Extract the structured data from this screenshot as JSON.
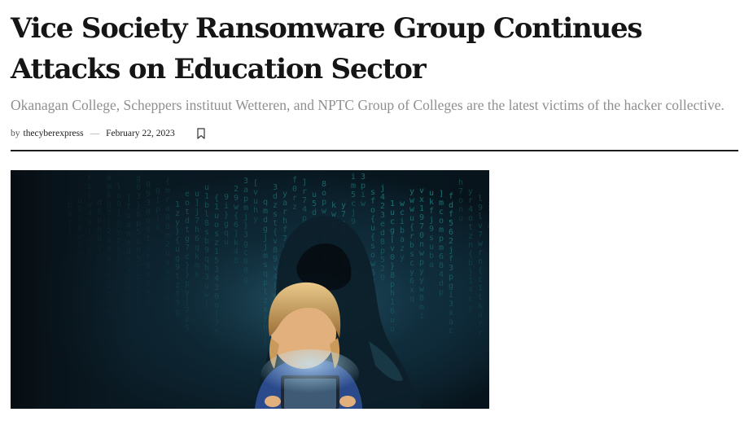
{
  "article": {
    "title": "Vice Society Ransomware Group Continues Attacks on Education Sector",
    "subtitle": "Okanagan College, Scheppers instituut Wetteren, and NPTC Group of Colleges are the latest victims of the hacker collective.",
    "meta": {
      "by": "by",
      "author": "thecyberexpress",
      "separator": "—",
      "date": "February 22, 2023",
      "bookmark_icon": "bookmark-icon"
    },
    "hero_image": {
      "subject": "child-with-tablet-and-hooded-figure-matrix-code",
      "accent": "#2fd0c8"
    }
  }
}
